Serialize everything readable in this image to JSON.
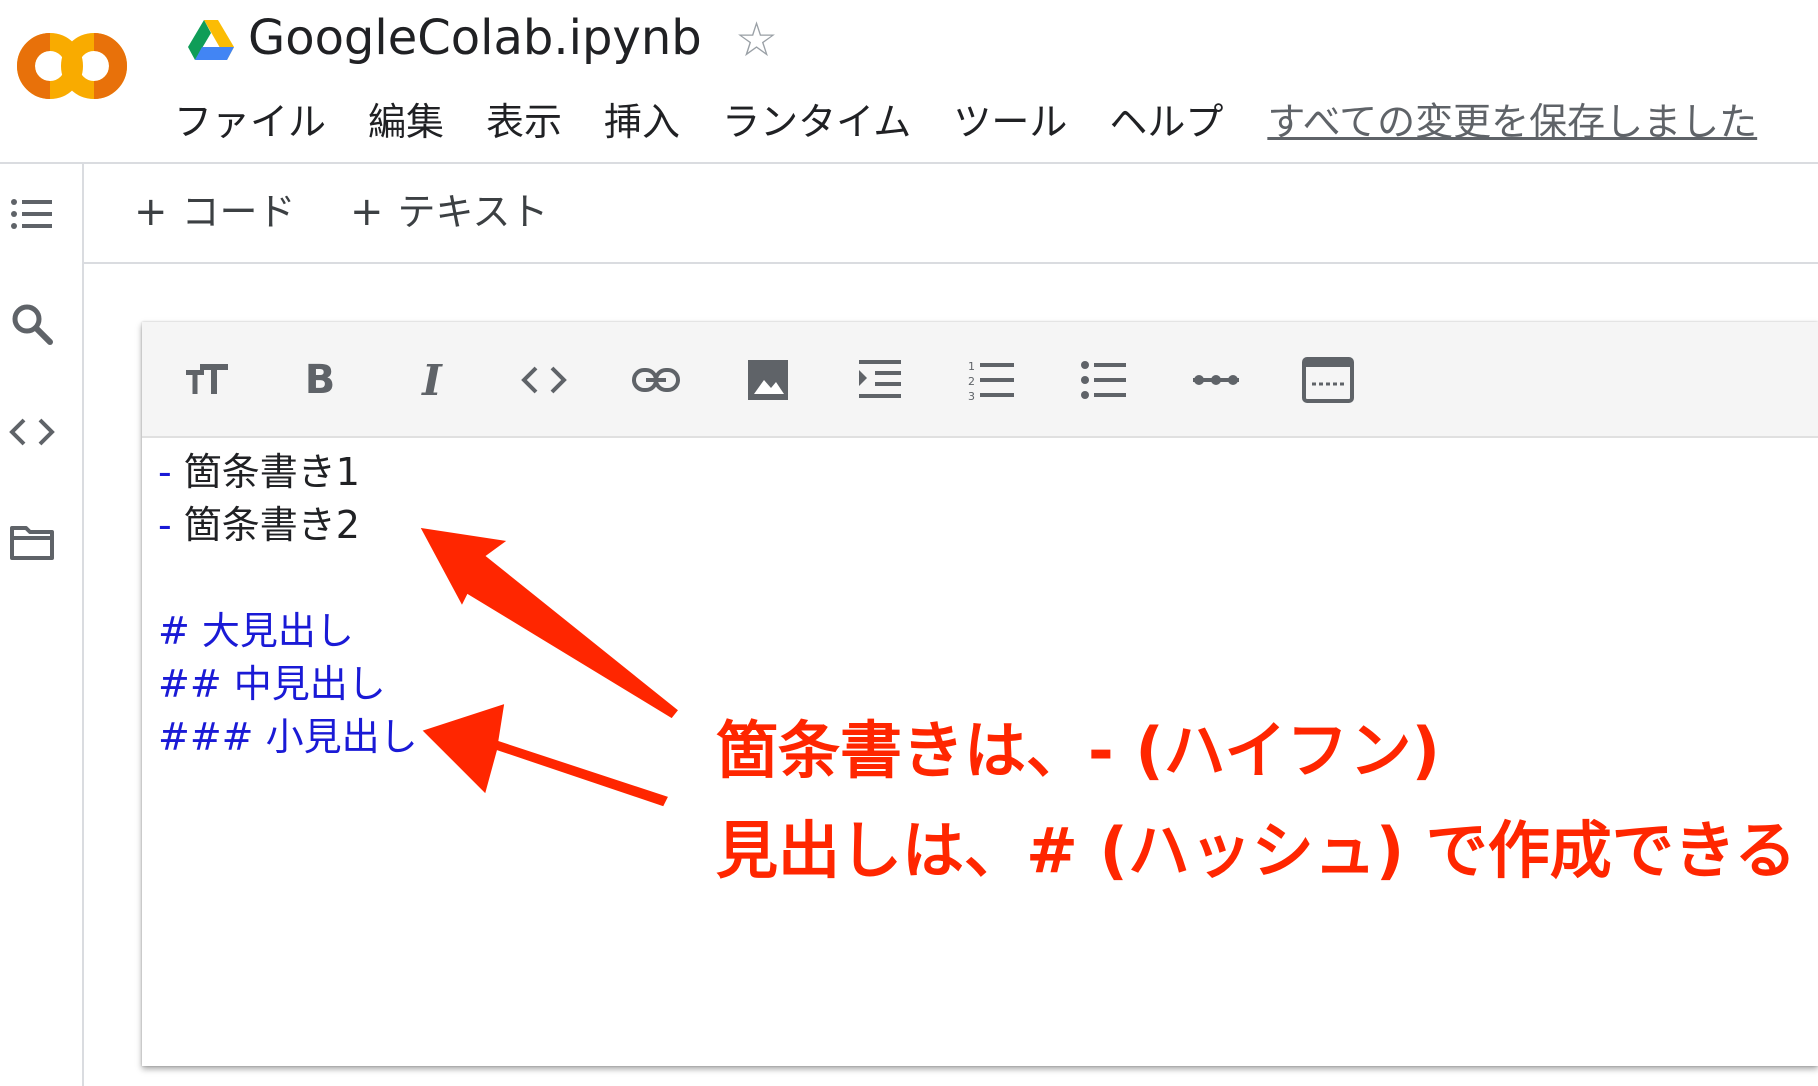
{
  "app": {
    "notebook_title": "GoogleColab.ipynb",
    "logo_icon": "colab-logo",
    "drive_icon": "google-drive-icon",
    "star_icon": "star-outline-icon"
  },
  "menu": {
    "items": [
      "ファイル",
      "編集",
      "表示",
      "挿入",
      "ランタイム",
      "ツール",
      "ヘルプ"
    ],
    "save_status": "すべての変更を保存しました"
  },
  "sidebar": {
    "icons": [
      "table-of-contents-icon",
      "search-icon",
      "code-snippets-icon",
      "folder-icon"
    ]
  },
  "cell_toolbar": {
    "add_code_label": "コード",
    "add_text_label": "テキスト",
    "plus": "+"
  },
  "markdown_toolbar": {
    "icons": [
      "text-size-icon",
      "bold-icon",
      "italic-icon",
      "code-icon",
      "link-icon",
      "image-icon",
      "indent-icon",
      "numbered-list-icon",
      "bulleted-list-icon",
      "horizontal-rule-icon",
      "preview-window-icon"
    ]
  },
  "editor": {
    "lines": [
      {
        "prefix": "-",
        "text": " 箇条書き1"
      },
      {
        "prefix": "-",
        "text": " 箇条書き2"
      },
      {
        "prefix": "",
        "text": ""
      },
      {
        "prefix": "#",
        "text": " 大見出し"
      },
      {
        "prefix": "##",
        "text": " 中見出し"
      },
      {
        "prefix": "###",
        "text": " 小見出し"
      }
    ]
  },
  "annotations": {
    "line1": "箇条書きは、- (ハイフン)",
    "line2": "見出しは、# (ハッシュ) で作成できる",
    "color": "#ff2600"
  },
  "colors": {
    "markdown_syntax": "#1a1ad6",
    "text": "#202124",
    "border": "#dadce0"
  }
}
